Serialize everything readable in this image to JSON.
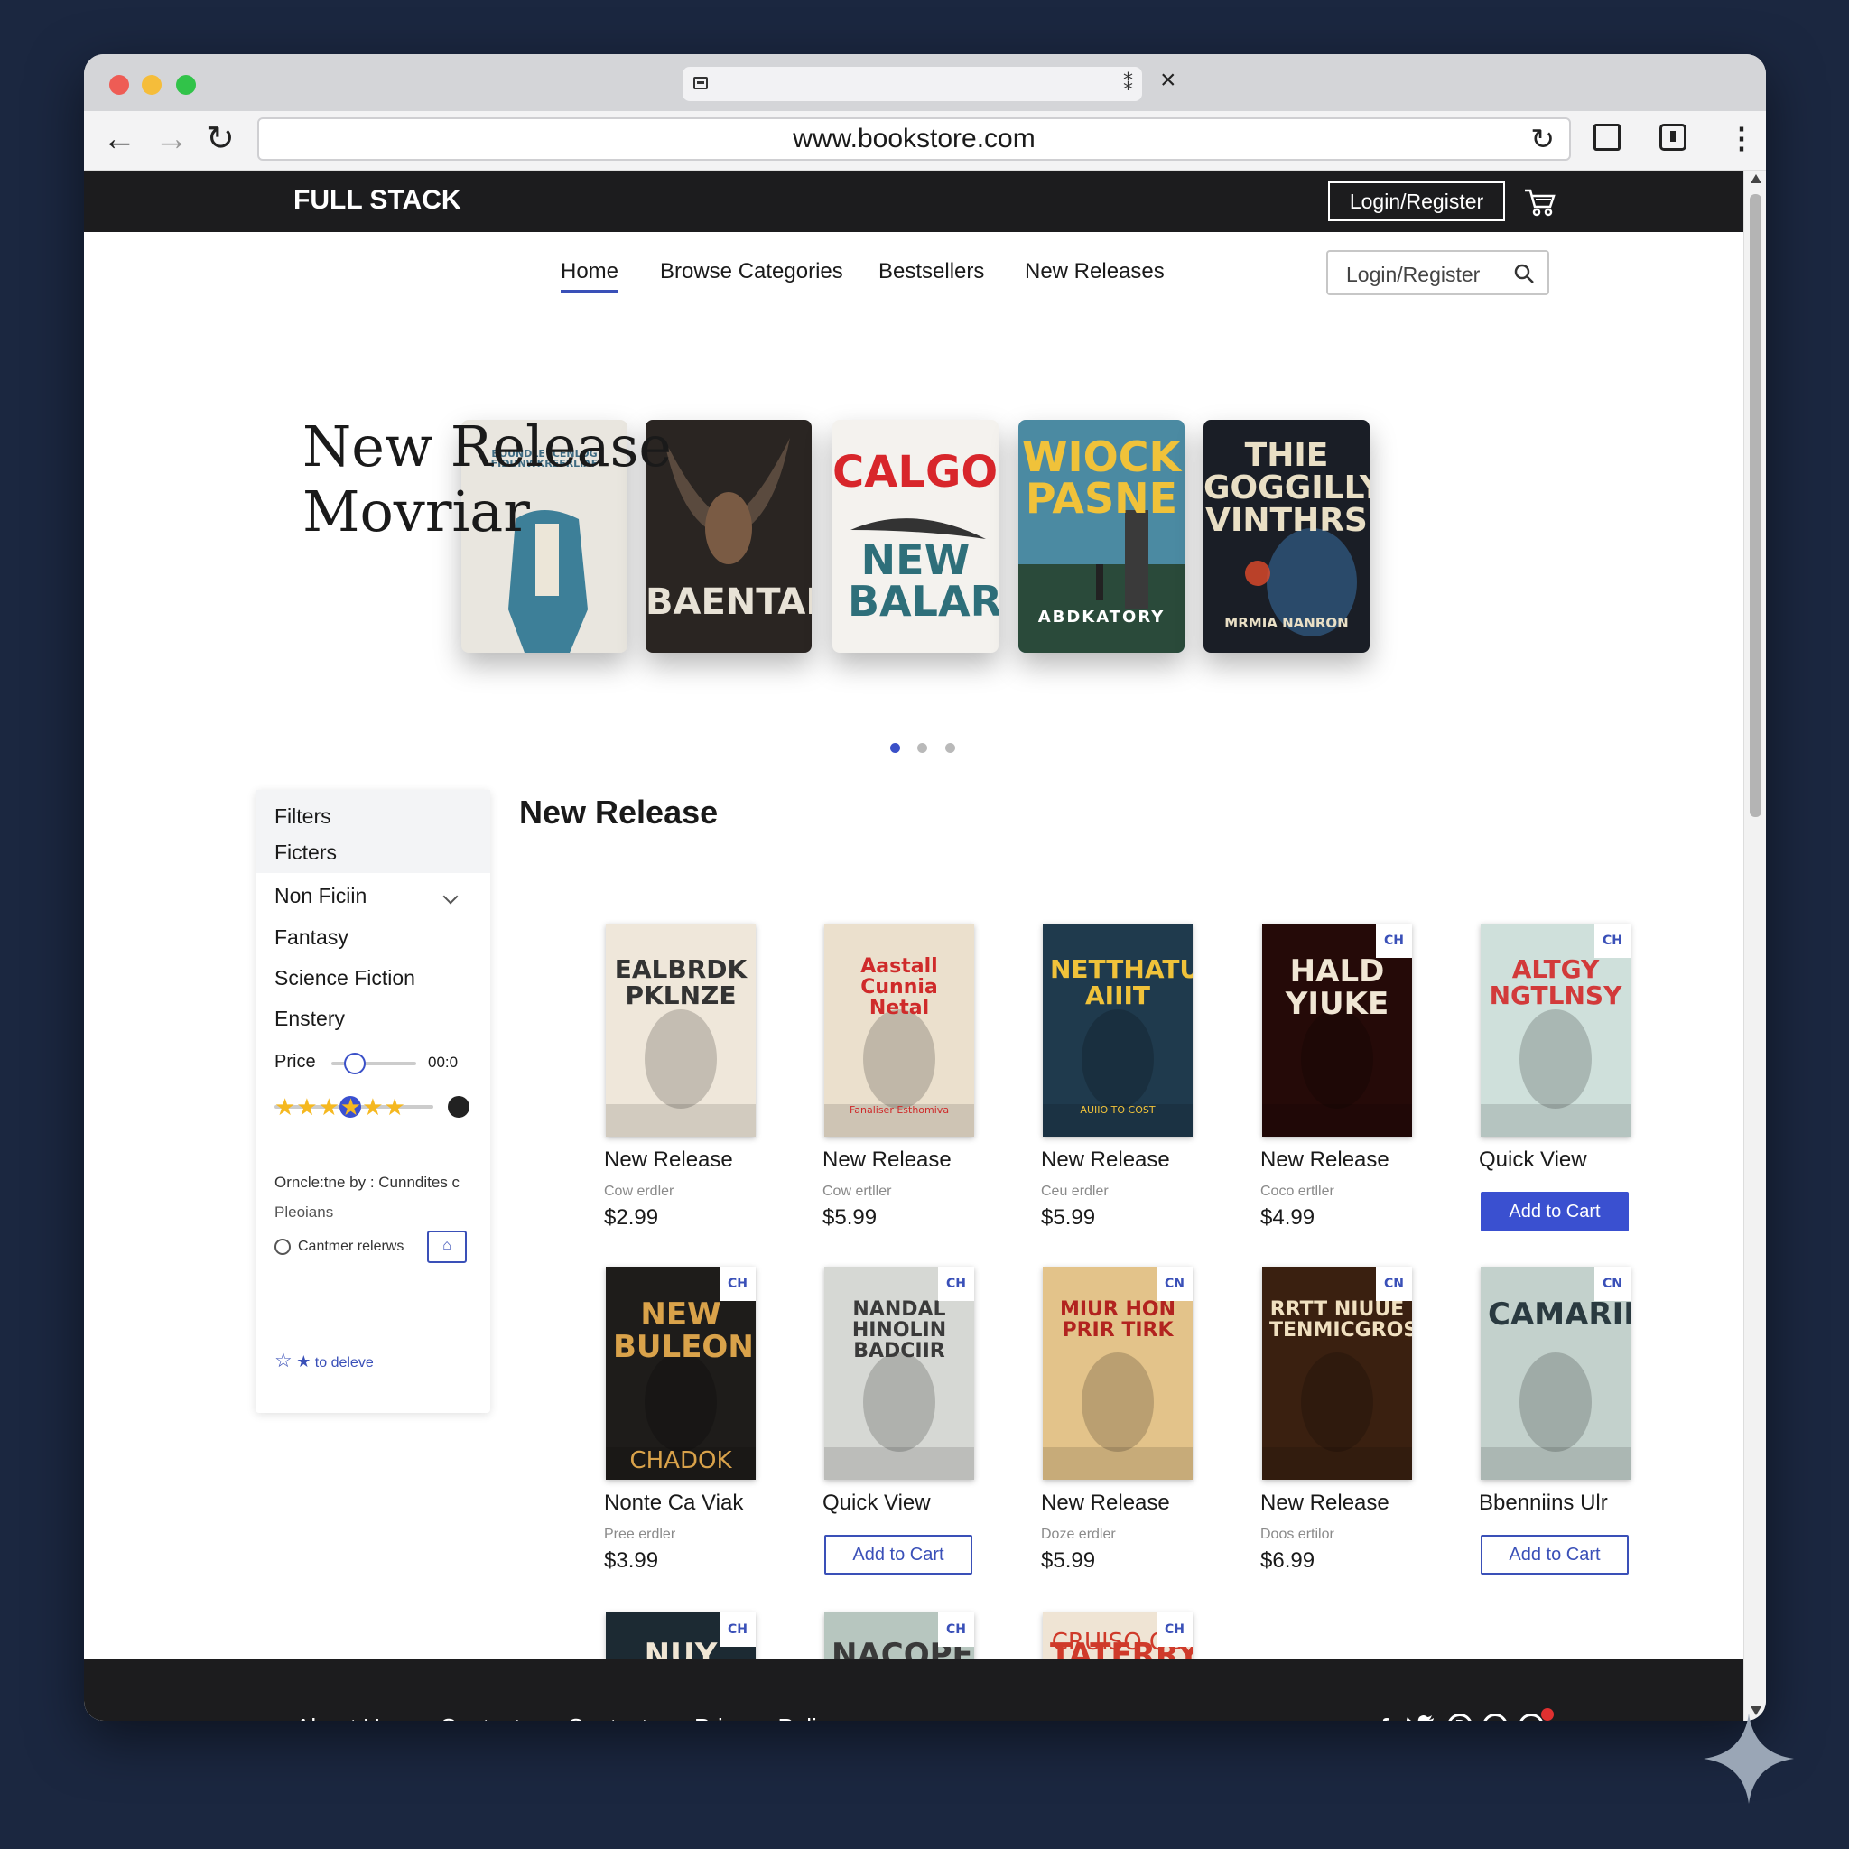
{
  "browser": {
    "url": "www.bookstore.com",
    "tab_close": "⁑",
    "window_close": "×"
  },
  "site": {
    "brand": "FULL STACK",
    "top_login": "Login/Register",
    "nav": [
      "Home",
      "Browse Categories",
      "Bestsellers",
      "New Releases"
    ],
    "search_placeholder": "Login/Register"
  },
  "hero": {
    "title_line1": "New Release",
    "title_line2": "Movriar",
    "books": [
      {
        "title": "BOUNDLE ICENLOG FIDUNWKREFRLIAF",
        "bg": "#e9e6df",
        "fg": "#3f6b82"
      },
      {
        "title": "BAENTABS",
        "bg": "#2a2522",
        "fg": "#e8e2d6"
      },
      {
        "title": "CALGONE",
        "subtitle": "NEW BALARE",
        "bg": "#f4f2ee",
        "fg": "#d8262b",
        "fg2": "#2e6f7a"
      },
      {
        "title": "WIOCK PASNE",
        "subtitle": "ABDKATORY",
        "bg": "#4b8aa2",
        "fg": "#f0c23a",
        "fg2": "#ffffff"
      },
      {
        "title": "THIE GOGGILLY VINTHRS",
        "subtitle": "MRMIA NANRON",
        "bg": "#1a1e26",
        "fg": "#e9dfc5",
        "fg2": "#e9dfc5"
      }
    ]
  },
  "filters": {
    "heading1": "Filters",
    "heading2": "Ficters",
    "dropdown": "Non Ficiin",
    "categories": [
      "Fantasy",
      "Science Fiction",
      "Enstery"
    ],
    "price_label": "Price",
    "price_value": "00:0",
    "order_text": "Orncle:tne by : Cunndites c",
    "order_sub": "Pleoians",
    "customer_reviews": "Cantmer relerws",
    "stars": "★★★★★★",
    "to_delete": "to deleve"
  },
  "section_title": "New Release",
  "products": [
    {
      "cover_title": "EALBRDK PKLNZE",
      "cover_sub": "",
      "bg": "#efe7da",
      "fg": "#333333",
      "badge": "",
      "title": "New Release",
      "sub": "Cow erdler",
      "price": "$2.99",
      "button": ""
    },
    {
      "cover_title": "Aastall Cunnia Netal",
      "cover_sub": "Fanaliser Esthomiva",
      "bg": "#ebe0cd",
      "fg": "#cf2a2a",
      "badge": "",
      "title": "New Release",
      "sub": "Cow ertller",
      "price": "$5.99",
      "button": ""
    },
    {
      "cover_title": "NETTHATUN AIIIT",
      "cover_sub": "AUIIO TO COST",
      "bg": "#1f3a4d",
      "fg": "#f0c23a",
      "badge": "",
      "title": "New Release",
      "sub": "Ceu erdler",
      "price": "$5.99",
      "button": ""
    },
    {
      "cover_title": "HALD YIUKE",
      "cover_sub": "",
      "bg": "#250a08",
      "fg": "#f0e6d4",
      "badge": "CH",
      "title": "New Release",
      "sub": "Coco ertller",
      "price": "$4.99",
      "button": ""
    },
    {
      "cover_title": "ALTGY NGTLNSY",
      "cover_sub": "",
      "bg": "#cfe0db",
      "fg": "#d23a3a",
      "badge": "CH",
      "title": "Quick View",
      "sub": "",
      "price": "",
      "button": "Add to Cart",
      "button_style": "primary"
    },
    {
      "cover_title": "NEW BULEON",
      "cover_sub": "CHADOK",
      "bg": "#1e1c1a",
      "fg": "#d9a24a",
      "badge": "CH",
      "title": "Nonte Ca Viak",
      "sub": "Pree erdler",
      "price": "$3.99",
      "button": ""
    },
    {
      "cover_title": "NANDAL HINOLIN BADCIIR",
      "cover_sub": "",
      "bg": "#d6d8d4",
      "fg": "#3a3a3a",
      "badge": "CH",
      "title": "Quick View",
      "sub": "",
      "price": "",
      "button": "Add to Cart",
      "button_style": "outline"
    },
    {
      "cover_title": "MIUR HON PRIR TIRK",
      "cover_sub": "",
      "bg": "#e3c38a",
      "fg": "#b2231f",
      "badge": "CN",
      "title": "New Release",
      "sub": "Doze erdler",
      "price": "$5.99",
      "button": ""
    },
    {
      "cover_title": "RRTT NIUUE TENMICGROS",
      "cover_sub": "",
      "bg": "#3a2010",
      "fg": "#f0e0c0",
      "badge": "CN",
      "title": "New Release",
      "sub": "Doos ertilor",
      "price": "$6.99",
      "button": ""
    },
    {
      "cover_title": "CAMARIE",
      "cover_sub": "",
      "bg": "#c3d1cc",
      "fg": "#2a3a40",
      "badge": "CN",
      "title": "Bbenniins Ulr",
      "sub": "",
      "price": "",
      "button": "Add to Cart",
      "button_style": "outline"
    },
    {
      "cover_title": "NUY HARE",
      "cover_sub": "",
      "bg": "#1c2a33",
      "fg": "#f0e6d4",
      "badge": "CH",
      "title": "",
      "sub": "",
      "price": "",
      "button": ""
    },
    {
      "cover_title": "NACOPE",
      "cover_sub": "",
      "bg": "#b7c6bf",
      "fg": "#3a3a3a",
      "badge": "CH",
      "title": "",
      "sub": "",
      "price": "",
      "button": ""
    },
    {
      "cover_title": "TATERRY",
      "cover_sub": "CRUISO OB",
      "bg": "#efe4d4",
      "fg": "#cf3a2a",
      "badge": "CH",
      "title": "",
      "sub": "",
      "price": "",
      "button": ""
    }
  ],
  "footer": {
    "links": [
      "About Us",
      "Contact",
      "Contact",
      "Privacy Policy"
    ],
    "social": [
      "f",
      "twitter",
      "pinterest",
      "dribbble",
      "reddit"
    ]
  },
  "colors": {
    "accent": "#3a50d0",
    "dark": "#1c1c1e",
    "background": "#1b2740"
  }
}
